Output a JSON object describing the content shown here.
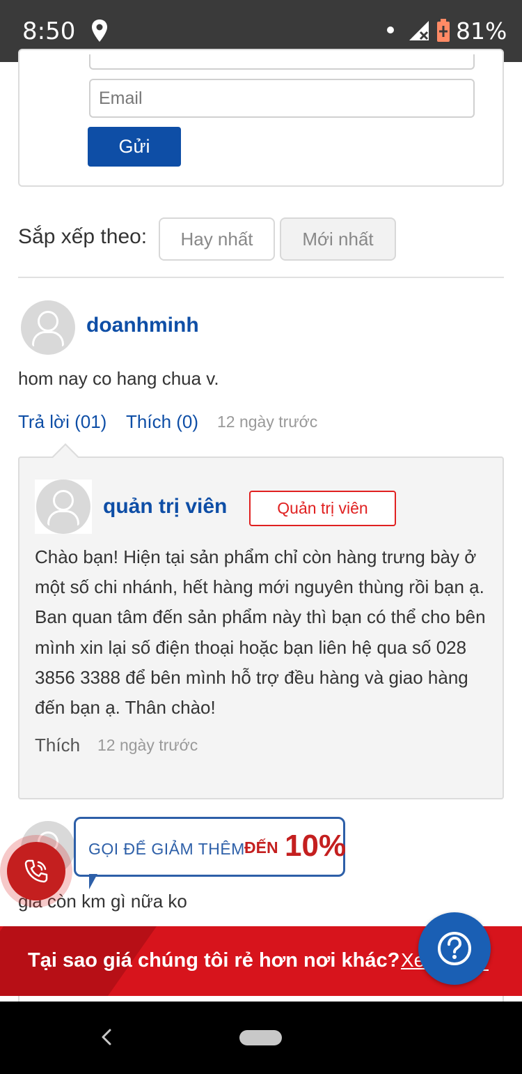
{
  "status_bar": {
    "time": "8:50",
    "battery_percent": "81%",
    "icons": [
      "location-icon",
      "signal-icon",
      "battery-charging-icon"
    ]
  },
  "form": {
    "email_placeholder": "Email",
    "send_label": "Gửi"
  },
  "sort": {
    "label": "Sắp xếp theo:",
    "options": [
      "Hay nhất",
      "Mới nhất"
    ],
    "selected": "Mới nhất"
  },
  "comments": [
    {
      "user": "doanhminh",
      "text": "hom nay co hang chua v.",
      "reply_label": "Trả lời (01)",
      "like_label": "Thích (0)",
      "time": "12 ngày trước",
      "replies": [
        {
          "user": "quản trị viên",
          "badge": "Quản trị viên",
          "text": "Chào bạn! Hiện tại sản phẩm chỉ còn hàng trưng bày ở một số chi nhánh, hết hàng mới nguyên thùng rồi bạn ạ. Ban quan tâm đến sản phẩm này thì bạn có thể cho bên mình xin lại số điện thoại hoặc bạn liên hệ qua số 028 3856 3388 để bên mình hỗ trợ đều hàng và giao hàng đến bạn ạ. Thân chào!",
          "like_label": "Thích",
          "time": "12 ngày trước"
        }
      ]
    },
    {
      "user": "",
      "text": "giá còn km gì nữa ko"
    }
  ],
  "call_promo": {
    "text_main": "GỌI ĐỂ GIẢM THÊM",
    "text_highlight": "ĐẾN",
    "text_number": "10%"
  },
  "banner": {
    "text": "Tại sao giá chúng tôi rẻ hơn nơi khác?",
    "link": "Xe"
  },
  "colors": {
    "brand_blue": "#0e4ea6",
    "accent_red": "#d7141c"
  }
}
